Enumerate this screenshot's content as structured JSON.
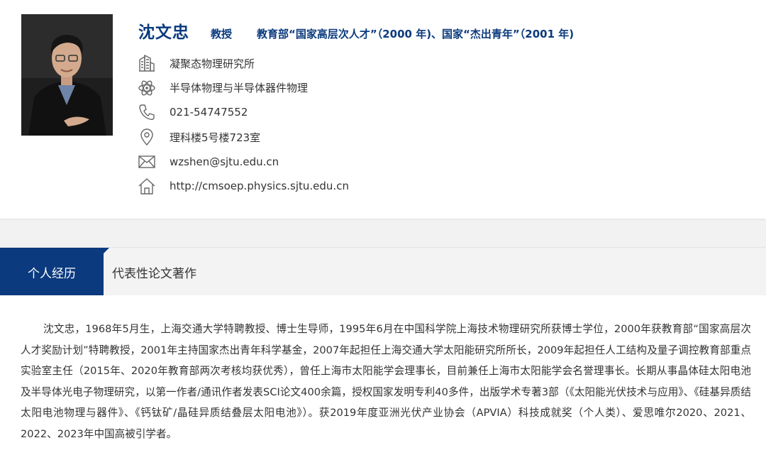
{
  "profile": {
    "name": "沈文忠",
    "rank": "教授",
    "honor": "教育部“国家高层次人才”（2000 年)、国家“杰出青年”（2001 年)",
    "info": [
      {
        "icon": "building-icon",
        "text": "凝聚态物理研究所"
      },
      {
        "icon": "atom-icon",
        "text": "半导体物理与半导体器件物理"
      },
      {
        "icon": "phone-icon",
        "text": "021-54747552"
      },
      {
        "icon": "location-pin-icon",
        "text": "理科楼5号楼723室"
      },
      {
        "icon": "mail-icon",
        "text": "wzshen@sjtu.edu.cn"
      },
      {
        "icon": "home-icon",
        "text": "http://cmsoep.physics.sjtu.edu.cn"
      }
    ]
  },
  "tabs": [
    {
      "label": "个人经历",
      "active": true
    },
    {
      "label": "代表性论文著作",
      "active": false
    }
  ],
  "bio": "沈文忠，1968年5月生，上海交通大学特聘教授、博士生导师，1995年6月在中国科学院上海技术物理研究所获博士学位，2000年获教育部“国家高层次人才奖励计划”特聘教授，2001年主持国家杰出青年科学基金，2007年起担任上海交通大学太阳能研究所所长，2009年起担任人工结构及量子调控教育部重点实验室主任（2015年、2020年教育部两次考核均获优秀），曾任上海市太阳能学会理事长，目前兼任上海市太阳能学会名誉理事长。长期从事晶体硅太阳电池及半导体光电子物理研究，以第一作者/通讯作者发表SCI论文400余篇，授权国家发明专利40多件，出版学术专著3部（《太阳能光伏技术与应用》、《硅基异质结太阳电池物理与器件》、《钙钛矿/晶硅异质结叠层太阳电池》）。获2019年度亚洲光伏产业协会（APVIA）科技成就奖（个人类）、爱思唯尔2020、2021、2022、2023年中国高被引学者。",
  "colors": {
    "brand": "#0b3a7e",
    "background": "#f2f2f2"
  }
}
